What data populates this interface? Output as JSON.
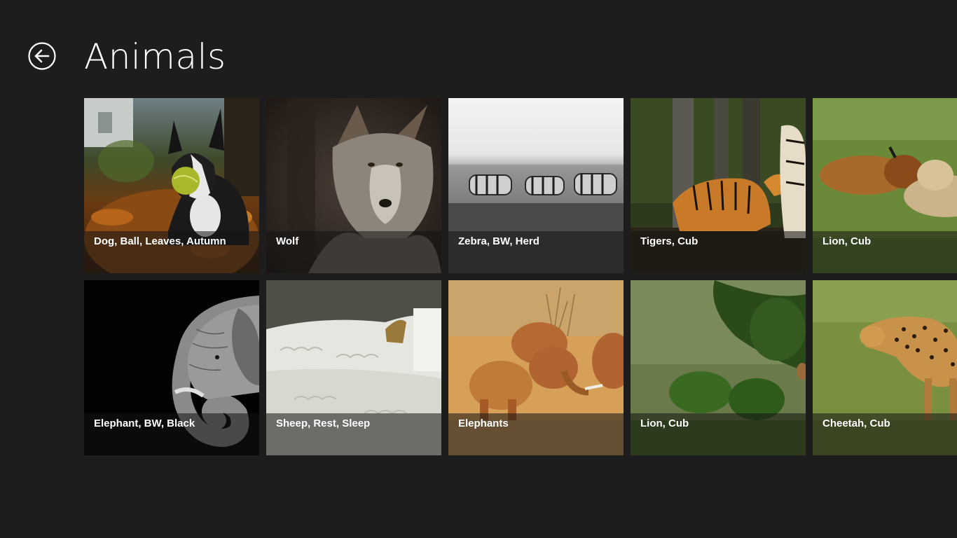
{
  "header": {
    "title": "Animals",
    "back_icon": "back-arrow-icon"
  },
  "tiles": [
    {
      "label": "Dog, Ball, Leaves, Autumn",
      "scene": "dog"
    },
    {
      "label": "Wolf",
      "scene": "wolf"
    },
    {
      "label": "Zebra, BW, Herd",
      "scene": "zebra"
    },
    {
      "label": "Tigers, Cub",
      "scene": "tiger"
    },
    {
      "label": "Lion, Cub",
      "scene": "lion"
    },
    {
      "label": "Elephant, BW, Black",
      "scene": "elephant-bw"
    },
    {
      "label": "Sheep, Rest, Sleep",
      "scene": "sheep"
    },
    {
      "label": "Elephants",
      "scene": "elephants"
    },
    {
      "label": "Lion, Cub",
      "scene": "lion-bush"
    },
    {
      "label": "Cheetah, Cub",
      "scene": "cheetah"
    }
  ],
  "colors": {
    "background": "#1d1d1d",
    "text": "#ffffff",
    "caption_overlay": "rgba(20,20,20,0.55)"
  }
}
